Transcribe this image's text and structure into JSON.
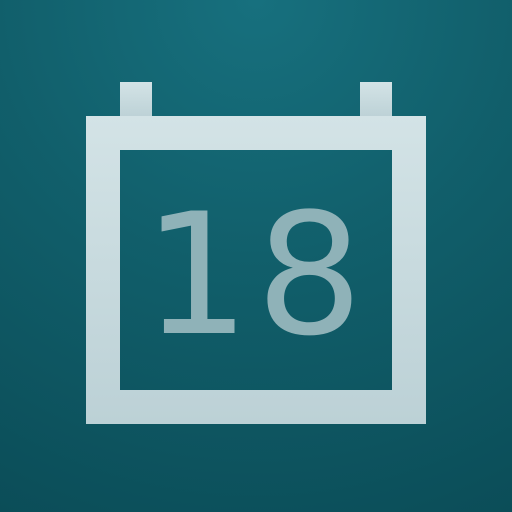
{
  "icon": {
    "name": "calendar-icon",
    "day": "18",
    "colors": {
      "frame": "#cfdfe3",
      "digits": "#8fb2b8",
      "background": "#115f6b"
    }
  }
}
